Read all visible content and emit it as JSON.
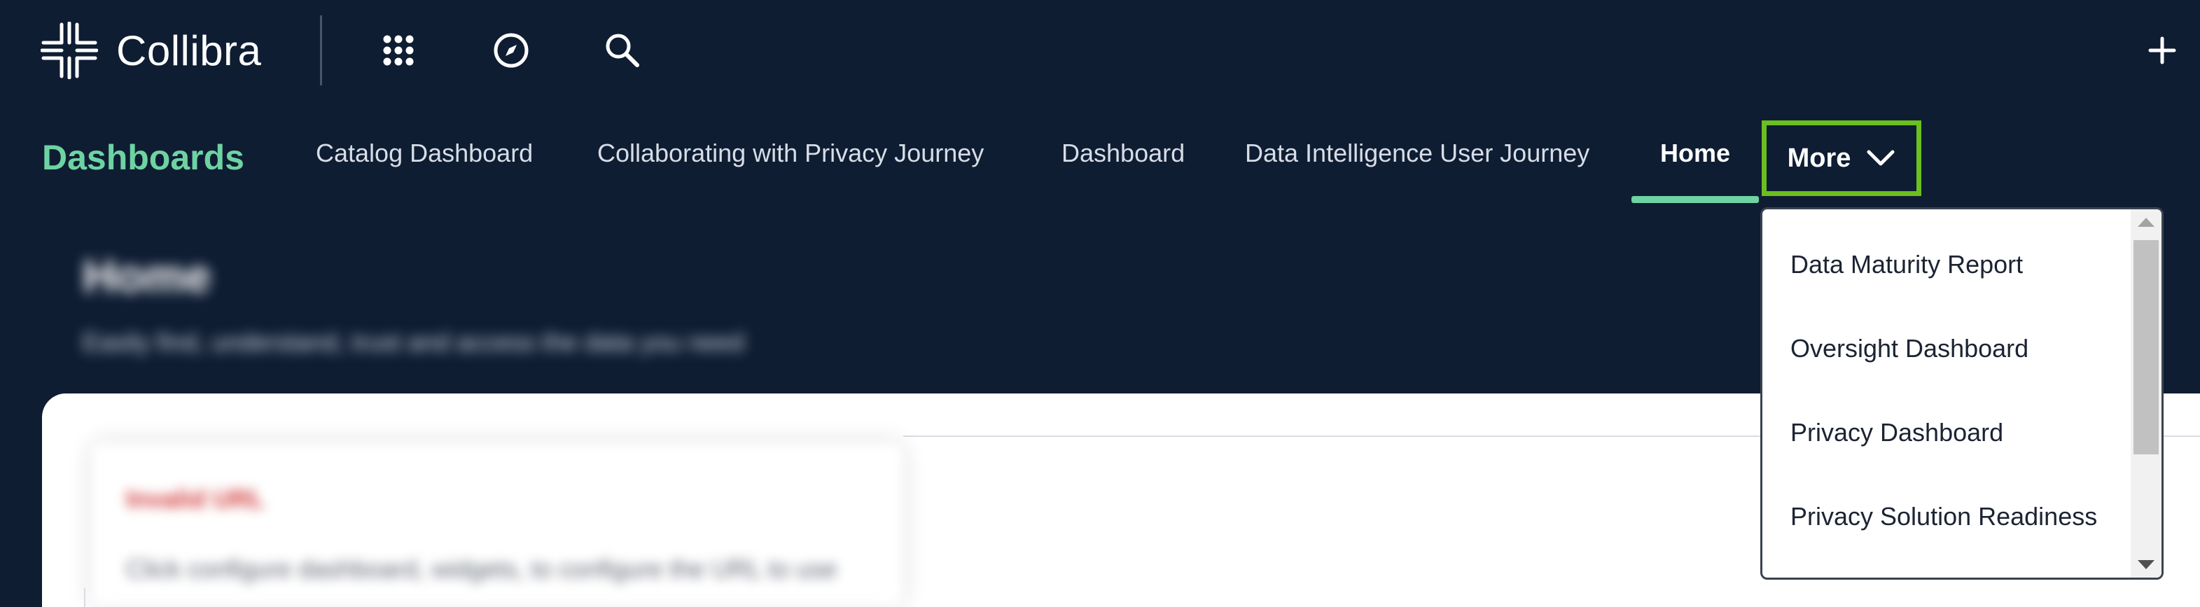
{
  "app": {
    "brand_name": "Collibra"
  },
  "topbar": {
    "icons": [
      "apps-grid-icon",
      "compass-icon",
      "search-icon",
      "plus-icon"
    ]
  },
  "dashboards_nav": {
    "title": "Dashboards",
    "tabs": [
      {
        "label": "Catalog Dashboard",
        "active": false
      },
      {
        "label": "Collaborating with Privacy Journey",
        "active": false
      },
      {
        "label": "Dashboard",
        "active": false
      },
      {
        "label": "Data Intelligence User Journey",
        "active": false
      },
      {
        "label": "Home",
        "active": true
      }
    ],
    "more_label": "More",
    "more_dropdown": {
      "open": true,
      "items": [
        "Data Maturity Report",
        "Oversight Dashboard",
        "Privacy Dashboard",
        "Privacy Solution Readiness"
      ]
    }
  },
  "page": {
    "title": "Home",
    "subtitle": "Easily find, understand, trust and access the data you need"
  },
  "widget": {
    "title": "Invalid URL",
    "description": "Click configure dashboard, widgets, to configure the URL to use"
  },
  "colors": {
    "background": "#0f1d33",
    "accent_green": "#6ed3a2",
    "highlight_border": "#6bbf1e",
    "error_red": "#d23b3b"
  }
}
